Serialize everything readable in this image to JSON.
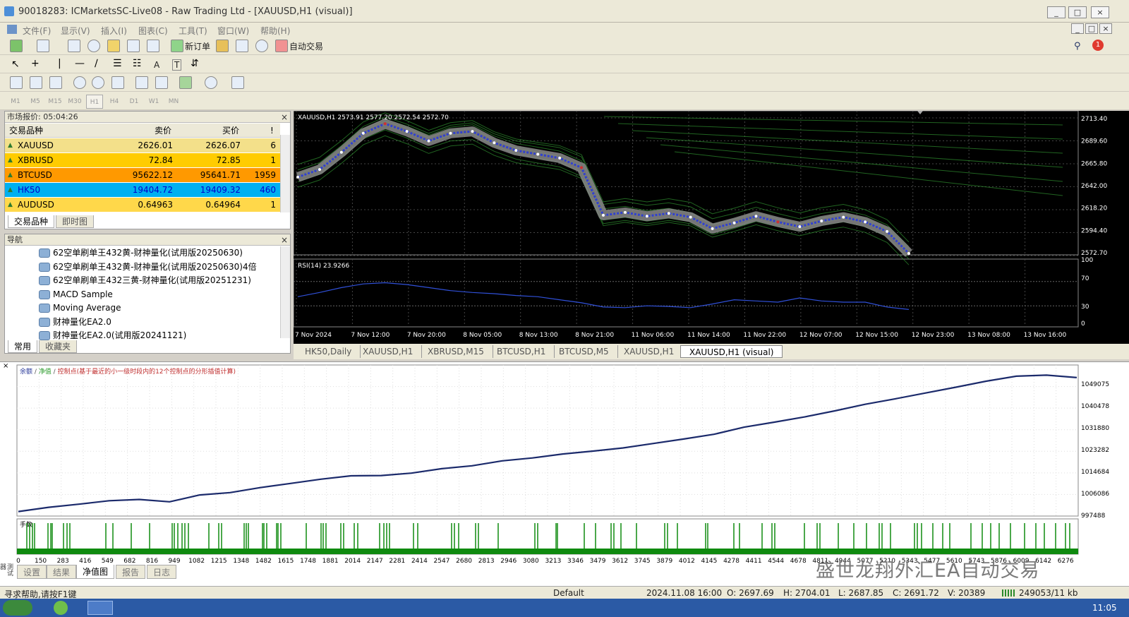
{
  "window": {
    "title": "90018283: ICMarketsSC-Live08 - Raw Trading Ltd - [XAUUSD,H1 (visual)]",
    "controls": [
      "_",
      "□",
      "×"
    ],
    "inner_controls": [
      "_",
      "□",
      "×"
    ]
  },
  "menu": [
    "文件(F)",
    "显示(V)",
    "插入(I)",
    "图表(C)",
    "工具(T)",
    "窗口(W)",
    "帮助(H)"
  ],
  "toolbar": {
    "new_order": "新订单",
    "auto_trade": "自动交易",
    "notification_count": "1",
    "text_tool": "A",
    "textlabel_tool": "T"
  },
  "timeframes": [
    "M1",
    "M5",
    "M15",
    "M30",
    "H1",
    "H4",
    "D1",
    "W1",
    "MN"
  ],
  "market_watch": {
    "header": "市场报价: 05:04:26",
    "columns": [
      "交易品种",
      "卖价",
      "买价",
      "!"
    ],
    "rows": [
      {
        "symbol": "XAUUSD",
        "bid": "2626.01",
        "ask": "2626.07",
        "spread": "6",
        "color": "#f3e08a",
        "text": "#000000"
      },
      {
        "symbol": "XBRUSD",
        "bid": "72.84",
        "ask": "72.85",
        "spread": "1",
        "color": "#ffcc00",
        "text": "#000000"
      },
      {
        "symbol": "BTCUSD",
        "bid": "95622.12",
        "ask": "95641.71",
        "spread": "1959",
        "color": "#ff9900",
        "text": "#000000"
      },
      {
        "symbol": "HK50",
        "bid": "19404.72",
        "ask": "19409.32",
        "spread": "460",
        "color": "#00b0f0",
        "text": "#0000cc"
      },
      {
        "symbol": "AUDUSD",
        "bid": "0.64963",
        "ask": "0.64964",
        "spread": "1",
        "color": "#ffd84a",
        "text": "#000000"
      }
    ],
    "tabs": [
      "交易品种",
      "即时图"
    ]
  },
  "navigator": {
    "header": "导航",
    "items": [
      "62空单刷单王432黄-财神量化(试用版20250630)",
      "62空单刷单王432黄-财神量化(试用版20250630)4倍",
      "62空单刷单王432三黄-财神量化(试用版20251231)",
      "MACD Sample",
      "Moving Average",
      "财神量化EA2.0",
      "财神量化EA2.0(试用版20241121)"
    ],
    "tabs": [
      "常用",
      "收藏夹"
    ]
  },
  "price_chart": {
    "label": "XAUUSD,H1 2573.91 2577.20 2572.54 2572.70",
    "price_ticks": [
      "2713.40",
      "2689.60",
      "2665.80",
      "2642.00",
      "2618.20",
      "2594.40",
      "2572.70"
    ],
    "time_ticks": [
      "7 Nov 2024",
      "7 Nov 12:00",
      "7 Nov 20:00",
      "8 Nov 05:00",
      "8 Nov 13:00",
      "8 Nov 21:00",
      "11 Nov 06:00",
      "11 Nov 14:00",
      "11 Nov 22:00",
      "12 Nov 07:00",
      "12 Nov 15:00",
      "12 Nov 23:00",
      "13 Nov 08:00",
      "13 Nov 16:00"
    ],
    "rsi_label": "RSI(14) 23.9266",
    "rsi_ticks": [
      "100",
      "70",
      "30",
      "0"
    ]
  },
  "chart_tabs": [
    "HK50,Daily",
    "XAUUSD,H1",
    "XBRUSD,M15",
    "BTCUSD,H1",
    "BTCUSD,M5",
    "XAUUSD,H1",
    "XAUUSD,H1 (visual)"
  ],
  "tester": {
    "legend_balance": "余额",
    "legend_equity": "净值",
    "legend_points": "控制点(基于最近的小一级时段内的12个控制点的分形插值计算)",
    "lots_label": "手数",
    "y_ticks": [
      "1049075",
      "1040478",
      "1031880",
      "1023282",
      "1014684",
      "1006086",
      "997488"
    ],
    "x_ticks": [
      "0",
      "150",
      "283",
      "416",
      "549",
      "682",
      "816",
      "949",
      "1082",
      "1215",
      "1348",
      "1482",
      "1615",
      "1748",
      "1881",
      "2014",
      "2147",
      "2281",
      "2414",
      "2547",
      "2680",
      "2813",
      "2946",
      "3080",
      "3213",
      "3346",
      "3479",
      "3612",
      "3745",
      "3879",
      "4012",
      "4145",
      "4278",
      "4411",
      "4544",
      "4678",
      "4811",
      "4944",
      "5077",
      "5210",
      "5343",
      "5477",
      "5610",
      "5743",
      "5876",
      "6009",
      "6142",
      "6276"
    ],
    "tabs": [
      "设置",
      "结果",
      "净值图",
      "报告",
      "日志"
    ],
    "side_label": "测试器"
  },
  "watermark": "盛世龙翔外汇EA自动交易",
  "status": {
    "help": "寻求帮助,请按F1键",
    "profile": "Default",
    "datetime": "2024.11.08 16:00",
    "open": "O: 2697.69",
    "high": "H: 2704.01",
    "low": "L: 2687.85",
    "close": "C: 2691.72",
    "volume": "V: 20389",
    "traffic": "249053/11 kb"
  },
  "taskbar_time": "11:05",
  "chart_data": [
    {
      "type": "line",
      "title": "",
      "series": [
        {
          "values": [
            2652,
            2660,
            2678,
            2698,
            2708,
            2700,
            2690,
            2698,
            2700,
            2688,
            2680,
            2676,
            2672,
            2662,
            2612,
            2615,
            2611,
            2614,
            2610,
            2598,
            2604,
            2611,
            2605,
            2600,
            2606,
            2610,
            2605,
            2595,
            2572
          ]
        }
      ],
      "ylim": [
        2572.7,
        2713.4
      ]
    },
    {
      "type": "line",
      "title": "",
      "series": [
        {
          "values": [
            45,
            52,
            60,
            66,
            68,
            65,
            60,
            55,
            52,
            50,
            47,
            45,
            40,
            35,
            28,
            27,
            30,
            29,
            27,
            33,
            40,
            38,
            36,
            43,
            38,
            36,
            36,
            28,
            24
          ]
        }
      ],
      "ylim": [
        0,
        100
      ]
    },
    {
      "type": "line",
      "title": "",
      "series": [
        {
          "values": [
            997600,
            999200,
            1000400,
            1001700,
            1002200,
            1001300,
            1003900,
            1004800,
            1006700,
            1008300,
            1009900,
            1011200,
            1011300,
            1012200,
            1013900,
            1015000,
            1016900,
            1018000,
            1019500,
            1020600,
            1021800,
            1023500,
            1025200,
            1027000,
            1029700,
            1031600,
            1033600,
            1035900,
            1038400,
            1040500,
            1042700,
            1044900,
            1047200,
            1049100,
            1049500,
            1048600
          ]
        }
      ],
      "ylim": [
        997488,
        1049075
      ]
    }
  ]
}
